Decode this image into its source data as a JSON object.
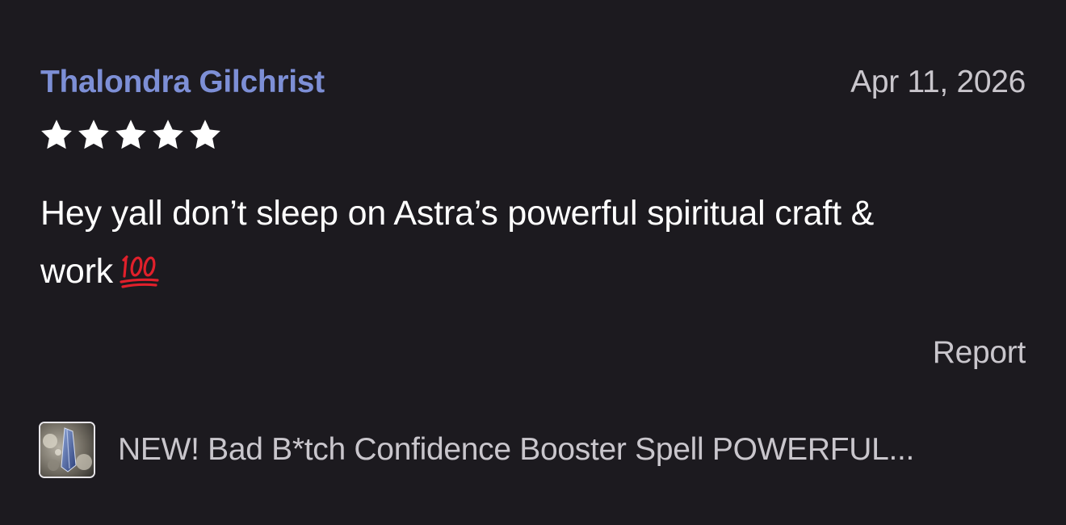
{
  "review": {
    "reviewer_name": "Thalondra Gilchrist",
    "date": "Apr 11, 2026",
    "rating": 5,
    "rating_max": 5,
    "body_line1": "Hey yall don’t sleep on Astra’s powerful spiritual craft &",
    "body_line2": "work",
    "emoji": "hundred-points-icon",
    "report_label": "Report",
    "product": {
      "title": "NEW! Bad B*tch Confidence Booster Spell POWERFUL...",
      "thumbnail_icon": "product-thumbnail-image"
    }
  },
  "colors": {
    "background": "#1c1a1f",
    "reviewer_name": "#7d8fd6",
    "secondary_text": "#c9c6cc",
    "primary_text": "#ffffff",
    "emoji_red": "#e0202b"
  }
}
